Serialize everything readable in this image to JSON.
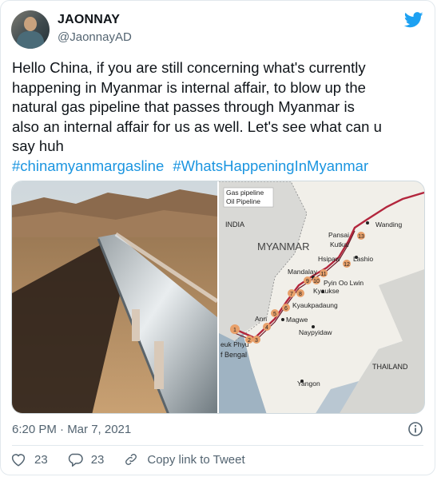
{
  "author": {
    "name": "JAONNAY",
    "handle": "@JaonnayAD"
  },
  "tweet": {
    "lines": [
      "Hello China, if you are still concerning what's currently",
      "happening in Myanmar is internal affair, to blow up the",
      "natural gas pipeline that passes through Myanmar is",
      "also an internal affair for us as well. Let's see what can u",
      "say huh"
    ],
    "hashtags": [
      "#chinamyanmargasline",
      "#WhatsHappeningInMyanmar"
    ]
  },
  "map": {
    "legend": [
      "Gas pipeline",
      "Oil Pipeline"
    ],
    "country_labels": [
      "INDIA",
      "MYANMAR",
      "THAILAND"
    ],
    "water_label": "f Bengal",
    "places": {
      "wanding": "Wanding",
      "pansai": "Pansai",
      "kutkai": "Kutkai",
      "hsipaw": "Hsipaw",
      "lashio": "Lashio",
      "mandalay": "Mandalay",
      "pyin_oo_lwin": "Pyin Oo Lwin",
      "kyaukse": "Kyaukse",
      "kyaukpadaung": "Kyaukpadaung",
      "magwe": "Magwe",
      "naypyidaw": "Naypyidaw",
      "yangon": "Yangon",
      "kyauk_phyu": "euk Phyu",
      "ann": "Ann"
    },
    "markers": [
      "1",
      "2",
      "3",
      "4",
      "5",
      "6",
      "7",
      "8",
      "9",
      "10",
      "11",
      "12",
      "13"
    ]
  },
  "timestamp": "6:20 PM · Mar 7, 2021",
  "actions": {
    "likes": "23",
    "replies": "23",
    "copy_link": "Copy link to Tweet"
  },
  "colors": {
    "brand": "#1da1f2",
    "hashtag": "#1b95e0",
    "muted": "#536471",
    "pipeline": "#b3263d",
    "marker": "#e8a06a"
  }
}
